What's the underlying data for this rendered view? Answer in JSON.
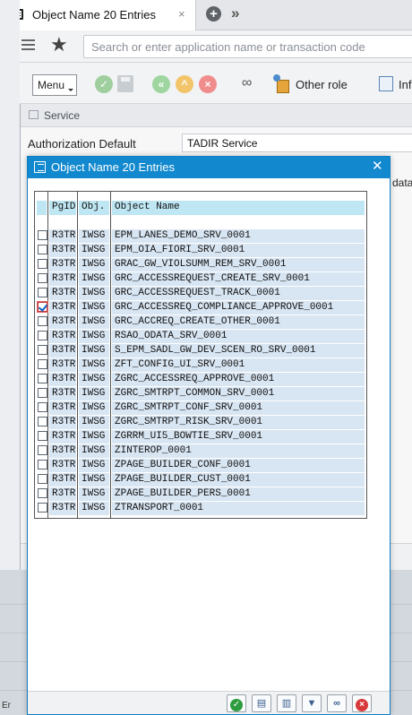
{
  "tab": {
    "title": "Object Name 20 Entries",
    "close": "×",
    "add": "+",
    "more": "»"
  },
  "search": {
    "placeholder": "Search or enter application name or transaction code"
  },
  "toolbar": {
    "menu_label": "Menu",
    "other_role_label": "Other role",
    "info_label": "Inf"
  },
  "service_dialog": {
    "title": "Service",
    "auth_label": "Authorization Default",
    "auth_value": "TADIR Service",
    "odata_fragment": "data",
    "bottom_label": "Er"
  },
  "popup": {
    "title": "Object Name 20 Entries",
    "close": "✕",
    "columns": {
      "pgid": "PgID",
      "obj": "Obj.",
      "name": "Object Name"
    },
    "rows": [
      {
        "pgid": "R3TR",
        "obj": "IWSG",
        "name": "EPM_LANES_DEMO_SRV_0001",
        "checked": false
      },
      {
        "pgid": "R3TR",
        "obj": "IWSG",
        "name": "EPM_OIA_FIORI_SRV_0001",
        "checked": false
      },
      {
        "pgid": "R3TR",
        "obj": "IWSG",
        "name": "GRAC_GW_VIOLSUMM_REM_SRV_0001",
        "checked": false
      },
      {
        "pgid": "R3TR",
        "obj": "IWSG",
        "name": "GRC_ACCESSREQUEST_CREATE_SRV_0001",
        "checked": false
      },
      {
        "pgid": "R3TR",
        "obj": "IWSG",
        "name": "GRC_ACCESSREQUEST_TRACK_0001",
        "checked": false
      },
      {
        "pgid": "R3TR",
        "obj": "IWSG",
        "name": "GRC_ACCESSREQ_COMPLIANCE_APPROVE_0001",
        "checked": true
      },
      {
        "pgid": "R3TR",
        "obj": "IWSG",
        "name": "GRC_ACCREQ_CREATE_OTHER_0001",
        "checked": false
      },
      {
        "pgid": "R3TR",
        "obj": "IWSG",
        "name": "RSAO_ODATA_SRV_0001",
        "checked": false
      },
      {
        "pgid": "R3TR",
        "obj": "IWSG",
        "name": "S_EPM_SADL_GW_DEV_SCEN_RO_SRV_0001",
        "checked": false
      },
      {
        "pgid": "R3TR",
        "obj": "IWSG",
        "name": "ZFT_CONFIG_UI_SRV_0001",
        "checked": false
      },
      {
        "pgid": "R3TR",
        "obj": "IWSG",
        "name": "ZGRC_ACCESSREQ_APPROVE_0001",
        "checked": false
      },
      {
        "pgid": "R3TR",
        "obj": "IWSG",
        "name": "ZGRC_SMTRPT_COMMON_SRV_0001",
        "checked": false
      },
      {
        "pgid": "R3TR",
        "obj": "IWSG",
        "name": "ZGRC_SMTRPT_CONF_SRV_0001",
        "checked": false
      },
      {
        "pgid": "R3TR",
        "obj": "IWSG",
        "name": "ZGRC_SMTRPT_RISK_SRV_0001",
        "checked": false
      },
      {
        "pgid": "R3TR",
        "obj": "IWSG",
        "name": "ZGRRM_UI5_BOWTIE_SRV_0001",
        "checked": false
      },
      {
        "pgid": "R3TR",
        "obj": "IWSG",
        "name": "ZINTEROP_0001",
        "checked": false
      },
      {
        "pgid": "R3TR",
        "obj": "IWSG",
        "name": "ZPAGE_BUILDER_CONF_0001",
        "checked": false
      },
      {
        "pgid": "R3TR",
        "obj": "IWSG",
        "name": "ZPAGE_BUILDER_CUST_0001",
        "checked": false
      },
      {
        "pgid": "R3TR",
        "obj": "IWSG",
        "name": "ZPAGE_BUILDER_PERS_0001",
        "checked": false
      },
      {
        "pgid": "R3TR",
        "obj": "IWSG",
        "name": "ZTRANSPORT_0001",
        "checked": false
      }
    ],
    "footer_icons": [
      "checkmark-icon",
      "select-icon",
      "deselect-icon",
      "filter-icon",
      "find-icon",
      "cancel-icon"
    ]
  }
}
